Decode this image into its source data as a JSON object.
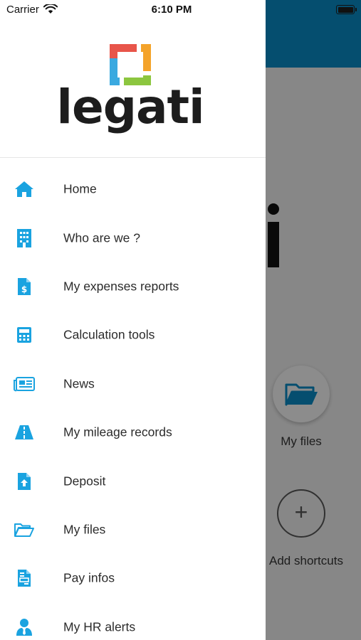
{
  "status_bar": {
    "carrier": "Carrier",
    "time": "6:10 PM"
  },
  "brand": {
    "name": "legati"
  },
  "menu": {
    "items": [
      {
        "label": "Home",
        "icon": "home-icon"
      },
      {
        "label": "Who are we ?",
        "icon": "building-icon"
      },
      {
        "label": "My expenses reports",
        "icon": "expense-document-icon"
      },
      {
        "label": "Calculation tools",
        "icon": "calculator-icon"
      },
      {
        "label": "News",
        "icon": "newspaper-icon"
      },
      {
        "label": "My mileage records",
        "icon": "road-icon"
      },
      {
        "label": "Deposit",
        "icon": "file-upload-icon"
      },
      {
        "label": "My files",
        "icon": "folder-open-icon"
      },
      {
        "label": "Pay infos",
        "icon": "pay-document-icon"
      },
      {
        "label": "My HR alerts",
        "icon": "user-tie-icon"
      }
    ]
  },
  "background": {
    "shortcuts": [
      {
        "label": "My files",
        "icon": "folder-open-icon"
      },
      {
        "label": "Add shortcuts",
        "icon": "plus-icon"
      }
    ]
  },
  "colors": {
    "accent": "#1aa3e0",
    "header": "#0a87c0",
    "text": "#2b2b2b"
  }
}
